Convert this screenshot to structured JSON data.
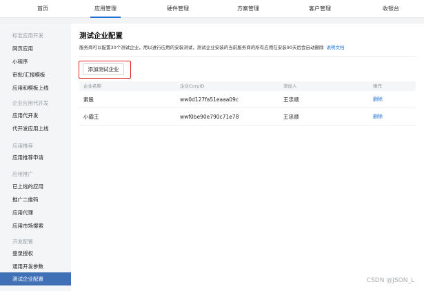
{
  "topnav": {
    "tabs": [
      {
        "label": "首页"
      },
      {
        "label": "应用管理"
      },
      {
        "label": "硬件管理"
      },
      {
        "label": "方案管理"
      },
      {
        "label": "客户管理"
      },
      {
        "label": "收银台"
      }
    ],
    "active": "应用管理"
  },
  "sidebar": {
    "groups": [
      {
        "title": "标准应用开发",
        "items": [
          "网页应用",
          "小程序",
          "审批/汇报模板",
          "应用和模板上线"
        ]
      },
      {
        "title": "企业应用代开发",
        "items": [
          "应用代开发",
          "代开发应用上线"
        ]
      },
      {
        "title": "应用推荐",
        "items": [
          "应用推荐申请"
        ]
      },
      {
        "title": "应用推广",
        "items": [
          "已上线的应用",
          "推广二维码",
          "应用代理",
          "应用市场搜索"
        ]
      },
      {
        "title": "开发配置",
        "items": [
          "登录授权",
          "通用开发参数",
          "测试企业配置"
        ]
      }
    ],
    "active_item": "测试企业配置"
  },
  "main": {
    "title": "测试企业配置",
    "description": "服务商可以配置30个测试企业，用以进行应用的安装测试，测试企业安装的当前服务商的所有应用在安装90天后会自动删除",
    "doc_link": "说明文档",
    "add_button": "添加测试企业",
    "table": {
      "headers": [
        "企业名称",
        "企业CorpID",
        "添加人",
        "操作"
      ],
      "rows": [
        {
          "name": "索股",
          "corpid": "ww0d127fa51eaaa09c",
          "adder": "王忠顺",
          "action": "删除"
        },
        {
          "name": "小霸王",
          "corpid": "wwf0be90e790c71e78",
          "adder": "王忠顺",
          "action": "删除"
        }
      ]
    }
  },
  "watermark": "CSDN @JSON_L",
  "colors": {
    "accent": "#1f6fd0",
    "sidebar_active": "#3f6fb5",
    "highlight": "#e02020"
  }
}
